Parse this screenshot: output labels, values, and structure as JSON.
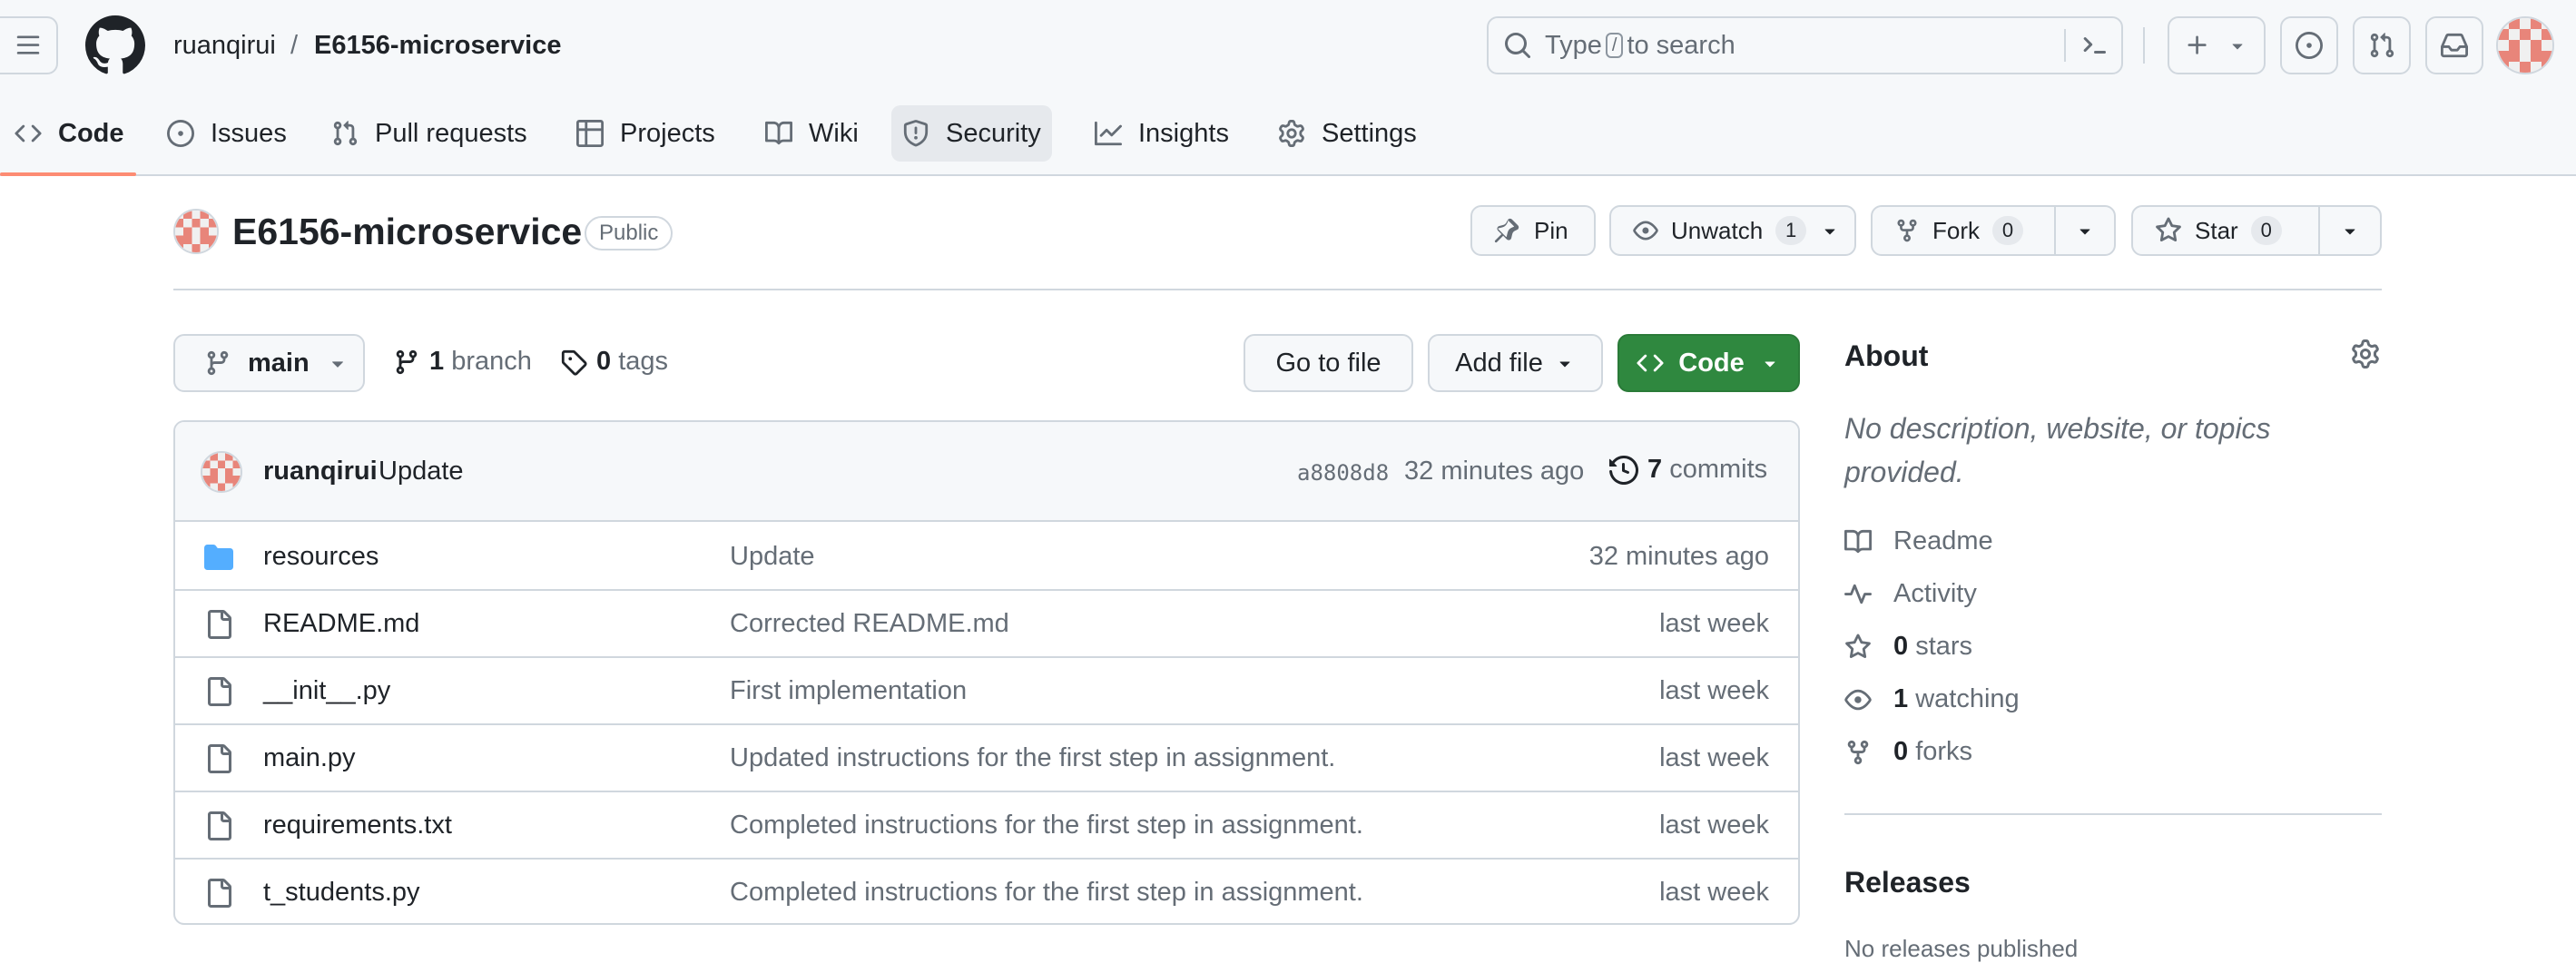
{
  "header": {
    "owner": "ruanqirui",
    "separator": "/",
    "repo": "E6156-microservice",
    "search": {
      "prefix": "Type",
      "key": "/",
      "suffix": "to search"
    }
  },
  "tabs": [
    {
      "label": "Code",
      "icon": "code-icon"
    },
    {
      "label": "Issues",
      "icon": "issue-opened-icon"
    },
    {
      "label": "Pull requests",
      "icon": "git-pull-request-icon"
    },
    {
      "label": "Projects",
      "icon": "table-icon"
    },
    {
      "label": "Wiki",
      "icon": "book-icon"
    },
    {
      "label": "Security",
      "icon": "shield-icon"
    },
    {
      "label": "Insights",
      "icon": "graph-icon"
    },
    {
      "label": "Settings",
      "icon": "gear-icon"
    }
  ],
  "repo_header": {
    "title": "E6156-microservice",
    "visibility": "Public",
    "pin_label": "Pin",
    "unwatch_label": "Unwatch",
    "unwatch_count": "1",
    "fork_label": "Fork",
    "fork_count": "0",
    "star_label": "Star",
    "star_count": "0"
  },
  "branch_bar": {
    "branch": "main",
    "branch_count": "1",
    "branch_word": "branch",
    "tag_count": "0",
    "tag_word": "tags",
    "goto_label": "Go to file",
    "addfile_label": "Add file",
    "code_label": "Code"
  },
  "latest_commit": {
    "author": "ruanqirui",
    "message": "Update",
    "sha": "a8808d8",
    "time": "32 minutes ago",
    "commit_count": "7",
    "commit_word": "commits"
  },
  "files": [
    {
      "name": "resources",
      "type": "dir",
      "message": "Update",
      "time": "32 minutes ago"
    },
    {
      "name": "README.md",
      "type": "file",
      "message": "Corrected README.md",
      "time": "last week"
    },
    {
      "name": "__init__.py",
      "type": "file",
      "message": "First implementation",
      "time": "last week"
    },
    {
      "name": "main.py",
      "type": "file",
      "message": "Updated instructions for the first step in assignment.",
      "time": "last week"
    },
    {
      "name": "requirements.txt",
      "type": "file",
      "message": "Completed instructions for the first step in assignment.",
      "time": "last week"
    },
    {
      "name": "t_students.py",
      "type": "file",
      "message": "Completed instructions for the first step in assignment.",
      "time": "last week"
    }
  ],
  "about": {
    "title": "About",
    "description": "No description, website, or topics provided.",
    "readme": "Readme",
    "activity": "Activity",
    "stars_count": "0",
    "stars_word": "stars",
    "watching_count": "1",
    "watching_word": "watching",
    "forks_count": "0",
    "forks_word": "forks"
  },
  "releases": {
    "title": "Releases",
    "note": "No releases published"
  },
  "colors": {
    "accent_green": "#2f883f",
    "tab_underline": "#fd8c73",
    "folder_blue": "#54aeff",
    "avatar_pattern": "#e8857a"
  }
}
